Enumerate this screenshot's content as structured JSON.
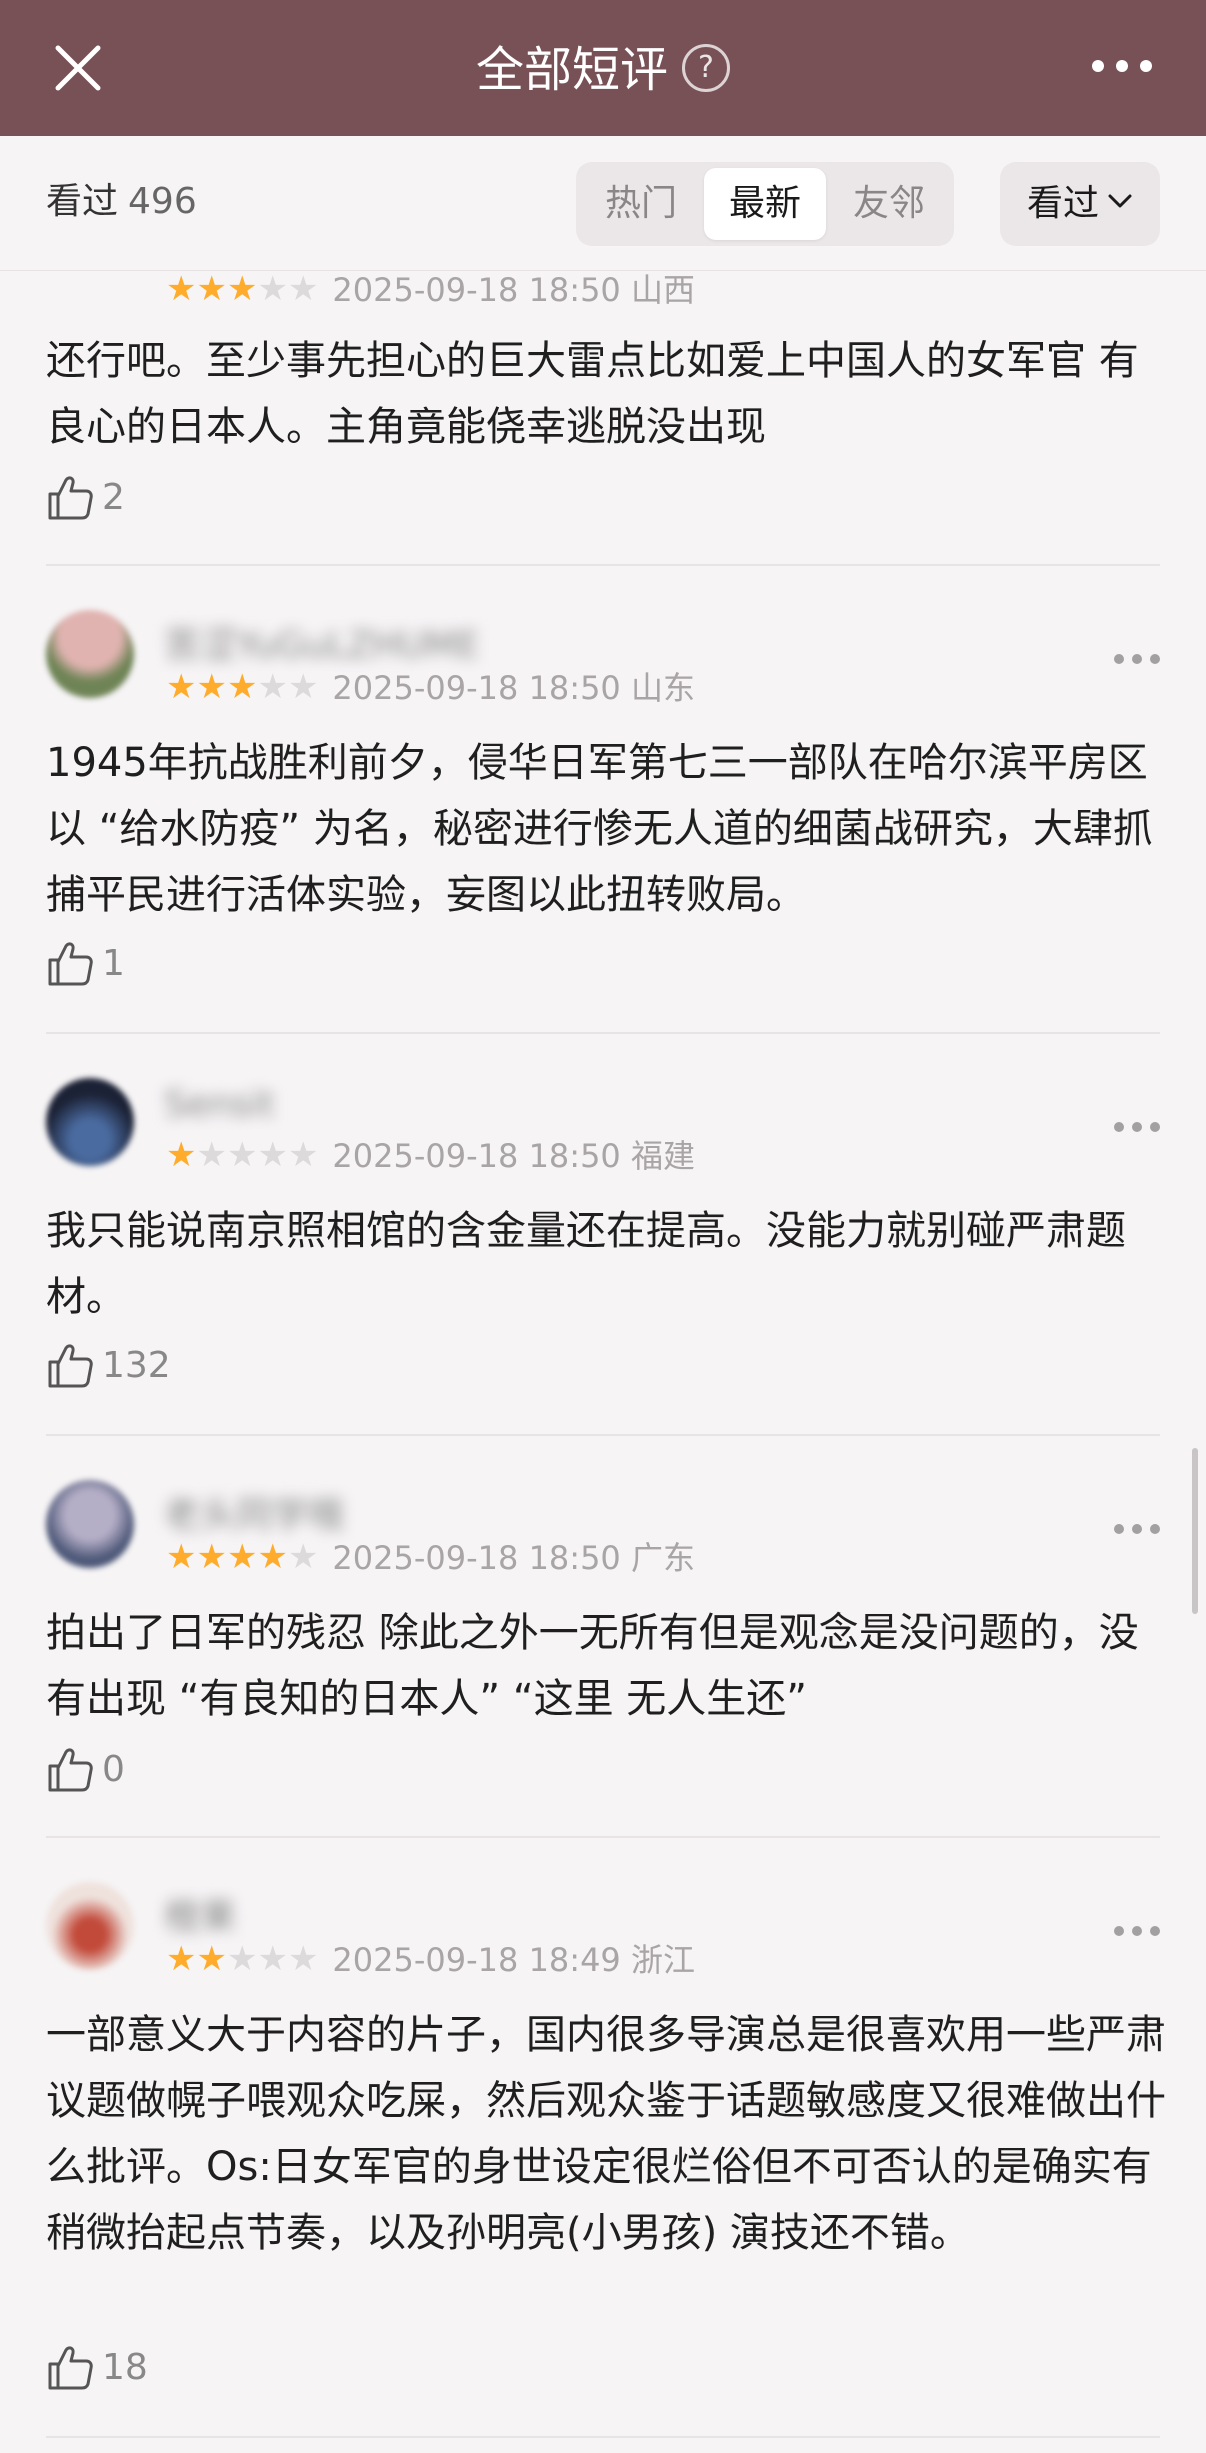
{
  "header": {
    "title": "全部短评",
    "help_glyph": "?"
  },
  "filter": {
    "seen_label": "看过",
    "seen_count": "496",
    "tabs": [
      "热门",
      "最新",
      "友邻"
    ],
    "active_tab": "最新",
    "dropdown_label": "看过"
  },
  "comments": [
    {
      "username": "",
      "stars": 3,
      "date": "2025-09-18 18:50",
      "location": "山西",
      "text": "还行吧。至少事先担心的巨大雷点比如爱上中国人的女军官 有良心的日本人。主角竟能侥幸逃脱没出现",
      "likes": "2",
      "avatar_color": "#a33a36"
    },
    {
      "username": "苦涩YuGuLZHUME",
      "stars": 3,
      "date": "2025-09-18 18:50",
      "location": "山东",
      "text": "1945年抗战胜利前夕，侵华日军第七三一部队在哈尔滨平房区以 “给水防疫” 为名，秘密进行惨无人道的细菌战研究，大肆抓捕平民进行活体实验，妄图以此扭转败局。",
      "likes": "1",
      "avatar_color": "#7f8e62"
    },
    {
      "username": "Sensit",
      "stars": 1,
      "date": "2025-09-18 18:50",
      "location": "福建",
      "text": "我只能说南京照相馆的含金量还在提高。没能力就别碰严肃题材。",
      "likes": "132",
      "avatar_color": "#2c3550"
    },
    {
      "username": "老头同学哦",
      "stars": 4,
      "date": "2025-09-18 18:50",
      "location": "广东",
      "text": "拍出了日军的残忍 除此之外一无所有但是观念是没问题的，没有出现 “有良知的日本人” “这里 无人生还”",
      "likes": "0",
      "avatar_color": "#7a7f9c"
    },
    {
      "username": "橙果",
      "stars": 2,
      "date": "2025-09-18 18:49",
      "location": "浙江",
      "text": "一部意义大于内容的片子，国内很多导演总是很喜欢用一些严肃议题做幌子喂观众吃屎，然后观众鉴于话题敏感度又很难做出什么批评。Os:日女军官的身世设定很烂俗但不可否认的是确实有稍微抬起点节奏，以及孙明亮(小男孩) 演技还不错。",
      "likes": "18",
      "avatar_color": "#d9b6aa"
    }
  ]
}
